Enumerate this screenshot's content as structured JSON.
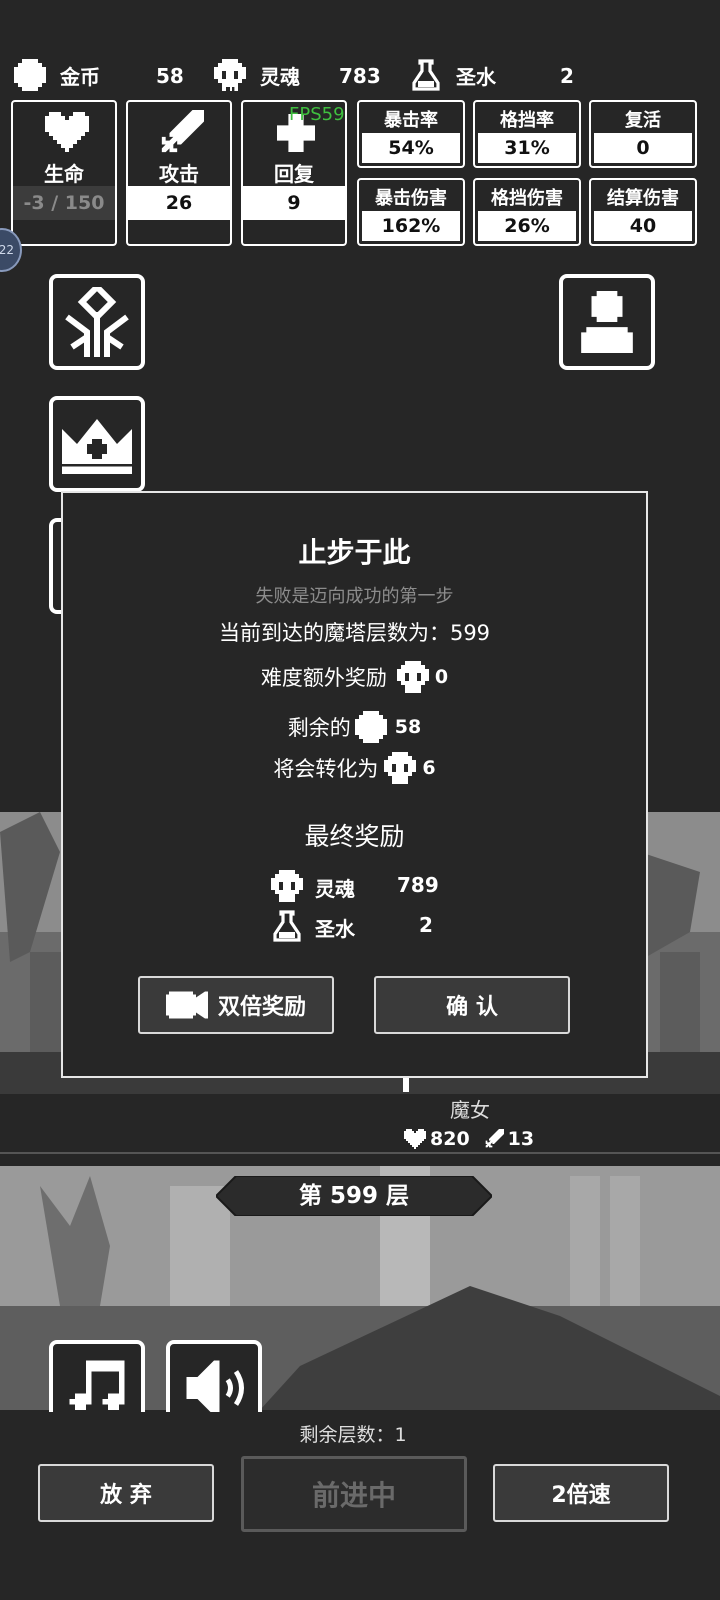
{
  "resources": {
    "gold": {
      "label": "金币",
      "value": "58"
    },
    "soul": {
      "label": "灵魂",
      "value": "783"
    },
    "holy_water": {
      "label": "圣水",
      "value": "2"
    }
  },
  "stats": {
    "hp": {
      "label": "生命",
      "value": "-3 / 150"
    },
    "attack": {
      "label": "攻击",
      "value": "26"
    },
    "recover": {
      "label": "回复",
      "value": "9"
    }
  },
  "fps": "FPS59",
  "attributes": [
    {
      "label": "暴击率",
      "value": "54%"
    },
    {
      "label": "格挡率",
      "value": "31%"
    },
    {
      "label": "复活",
      "value": "0"
    },
    {
      "label": "暴击伤害",
      "value": "162%"
    },
    {
      "label": "格挡伤害",
      "value": "26%"
    },
    {
      "label": "结算伤害",
      "value": "40"
    }
  ],
  "side_badge": "22",
  "modal": {
    "title": "止步于此",
    "subtitle": "失败是迈向成功的第一步",
    "floor_reached": "当前到达的魔塔层数为：599",
    "difficulty_bonus_label": "难度额外奖励",
    "difficulty_bonus_value": "0",
    "remaining_label": "剩余的",
    "remaining_value": "58",
    "convert_label": "将会转化为",
    "convert_value": "6",
    "final_reward_label": "最终奖励",
    "reward_soul_label": "灵魂",
    "reward_soul_value": "789",
    "reward_water_label": "圣水",
    "reward_water_value": "2",
    "double_button": "双倍奖励",
    "confirm_button": "确 认"
  },
  "enemy": {
    "name": "魔女",
    "hp": "820",
    "attack": "13"
  },
  "floor_banner": "第 599 层",
  "remaining_floors": "剩余层数：1",
  "bottom": {
    "give_up": "放 弃",
    "advancing": "前进中",
    "speed": "2倍速"
  },
  "colors": {
    "background": "#262626",
    "fps": "#3fbf3f",
    "card_value_bg": "#ffffff"
  }
}
